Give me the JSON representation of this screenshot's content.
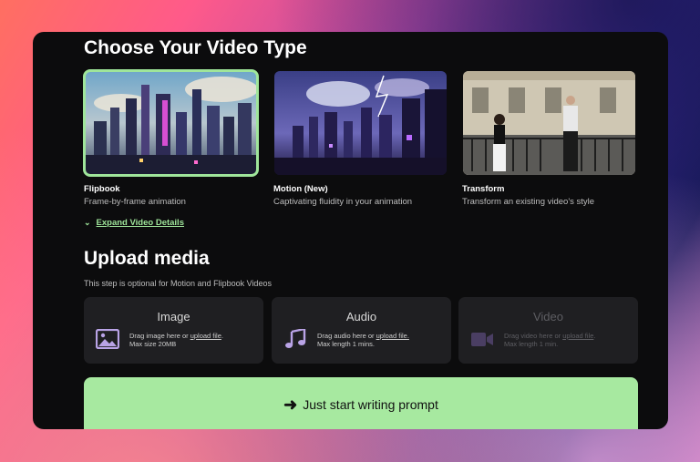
{
  "heading": "Choose Your Video Type",
  "video_types": [
    {
      "title": "Flipbook",
      "subtitle": "Frame-by-frame animation",
      "selected": true
    },
    {
      "title": "Motion (New)",
      "subtitle": "Captivating fluidity in your animation",
      "selected": false
    },
    {
      "title": "Transform",
      "subtitle": "Transform an existing video's style",
      "selected": false
    }
  ],
  "expand_label": "Expand Video Details",
  "upload": {
    "heading": "Upload media",
    "note": "This step is optional for Motion and Flipbook Videos",
    "items": [
      {
        "title": "Image",
        "line1_prefix": "Drag image here or ",
        "link": "upload file",
        "line1_suffix": ".",
        "line2": "Max size 20MB",
        "icon": "image-icon",
        "disabled": false
      },
      {
        "title": "Audio",
        "line1_prefix": "Drag audio here or ",
        "link": "upload file.",
        "line1_suffix": "",
        "line2": "Max length 1 mins.",
        "icon": "music-note-icon",
        "disabled": false
      },
      {
        "title": "Video",
        "line1_prefix": "Drag video here or ",
        "link": "upload file",
        "line1_suffix": ".",
        "line2": "Max length 1 min.",
        "icon": "video-camera-icon",
        "disabled": true
      }
    ]
  },
  "cta_label": "Just start writing prompt",
  "colors": {
    "accent_green": "#a7e9a0",
    "panel": "#0c0c0d",
    "card": "#1f1f22",
    "icon_purple": "#b9a3e6"
  }
}
